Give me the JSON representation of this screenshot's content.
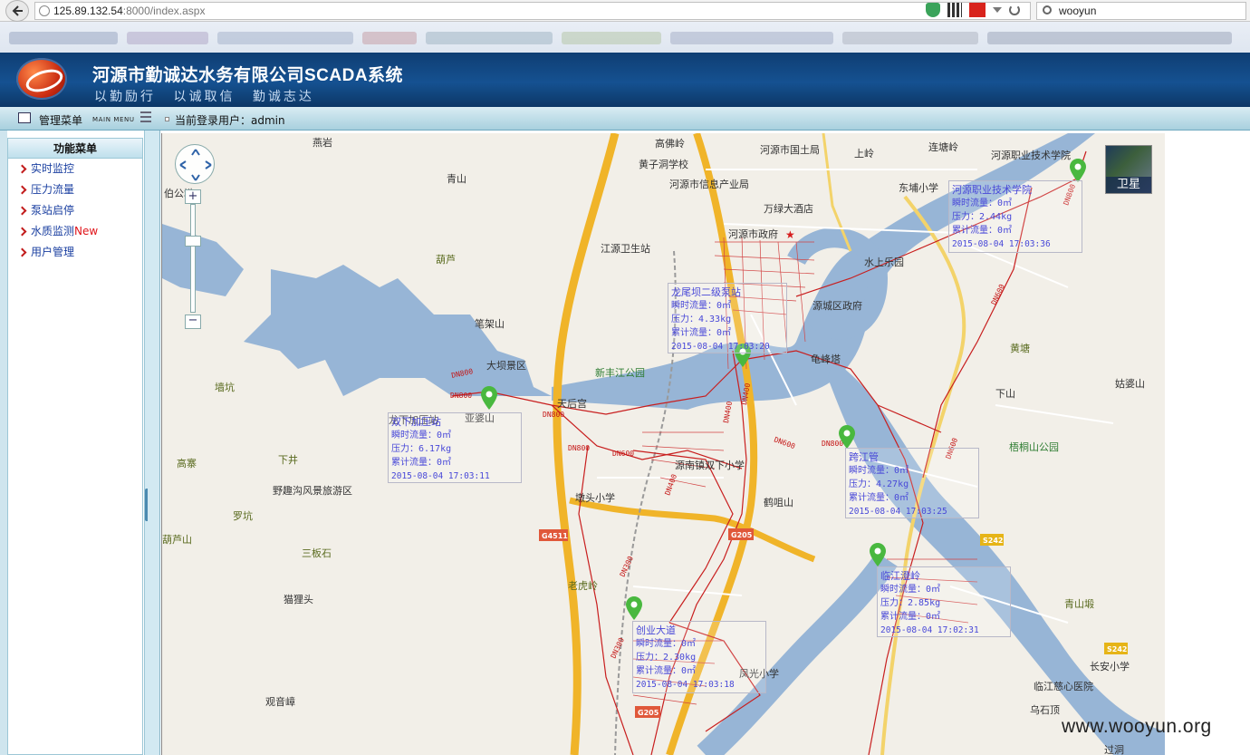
{
  "browser": {
    "url_main": "125.89.132.54",
    "url_rest": ":8000/index.aspx",
    "search_value": "wooyun"
  },
  "header": {
    "title": "河源市勤诚达水务有限公司SCADA系统",
    "slogan": "以勤励行  以诚取信  勤诚志达"
  },
  "menubar": {
    "title": "管理菜单",
    "subtitle": "MAIN MENU",
    "login_label": "当前登录用户：admin"
  },
  "sidebar": {
    "header": "功能菜单",
    "items": [
      {
        "label": "实时监控",
        "badge": ""
      },
      {
        "label": "压力流量",
        "badge": ""
      },
      {
        "label": "泵站启停",
        "badge": ""
      },
      {
        "label": "水质监测",
        "badge": "New"
      },
      {
        "label": "用户管理",
        "badge": ""
      }
    ]
  },
  "map": {
    "satellite_label": "卫星",
    "zoom_in": "+",
    "zoom_out": "−",
    "places": [
      "燕岩",
      "青山",
      "高佛岭",
      "黄子洞学校",
      "河源市国土局",
      "上岭",
      "连塘岭",
      "河源职业技术学院",
      "东埔小学",
      "河源市信息产业局",
      "万绿大酒店",
      "河源市政府",
      "江源卫生站",
      "葫芦",
      "水上乐园",
      "源城区政府",
      "笔架山",
      "龟峰塔",
      "黄塘",
      "姑婆山",
      "大坝景区",
      "新丰江公园",
      "天后宫",
      "下山",
      "墙坑",
      "龙下加压站",
      "亚婆山",
      "梧桐山公园",
      "高寨",
      "下井",
      "源南镇双下小学",
      "野趣沟风景旅游区",
      "墩头小学",
      "鹤咀山",
      "罗坑",
      "三板石",
      "青山塅",
      "猫狸头",
      "老虎岭",
      "凤光小学",
      "长安小学",
      "临江慈心医院",
      "观音嶂",
      "乌石顶",
      "过洞",
      "伯公坳",
      "葫芦山"
    ],
    "road_shields": [
      "G4511",
      "G205",
      "S242",
      "S242",
      "G205"
    ]
  },
  "stations": [
    {
      "name": "龙尾坝二级泵站",
      "flow": "瞬时流量：0㎡",
      "pressure": "压力：4.33kg",
      "total": "累计流量：0㎡",
      "time": "2015-08-04 17:03:20"
    },
    {
      "name": "河源职业技术学院",
      "flow": "瞬时流量：0㎡",
      "pressure": "压力：2.44kg",
      "total": "累计流量：0㎡",
      "time": "2015-08-04 17:03:36"
    },
    {
      "name": "双下加压站",
      "flow": "瞬时流量：0㎡",
      "pressure": "压力：6.17kg",
      "total": "累计流量：0㎡",
      "time": "2015-08-04 17:03:11"
    },
    {
      "name": "跨江管",
      "flow": "瞬时流量：0㎡",
      "pressure": "压力：4.27kg",
      "total": "累计流量：0㎡",
      "time": "2015-08-04 17:03:25"
    },
    {
      "name": "临江澄岭",
      "flow": "瞬时流量：0㎡",
      "pressure": "压力：2.85kg",
      "total": "累计流量：0㎡",
      "time": "2015-08-04 17:02:31"
    },
    {
      "name": "创业大道",
      "flow": "瞬时流量：0㎡",
      "pressure": "压力：2.30kg",
      "total": "累计流量：0㎡",
      "time": "2015-08-04 17:03:18"
    }
  ],
  "pipe_labels": [
    "DN800",
    "DN800",
    "DN800",
    "DN800",
    "DN600",
    "DN600",
    "DN600",
    "DN400",
    "DN400",
    "DN400",
    "DN300",
    "DN300",
    "DN600",
    "DN800",
    "DN800"
  ],
  "watermark": "www.wooyun.org"
}
